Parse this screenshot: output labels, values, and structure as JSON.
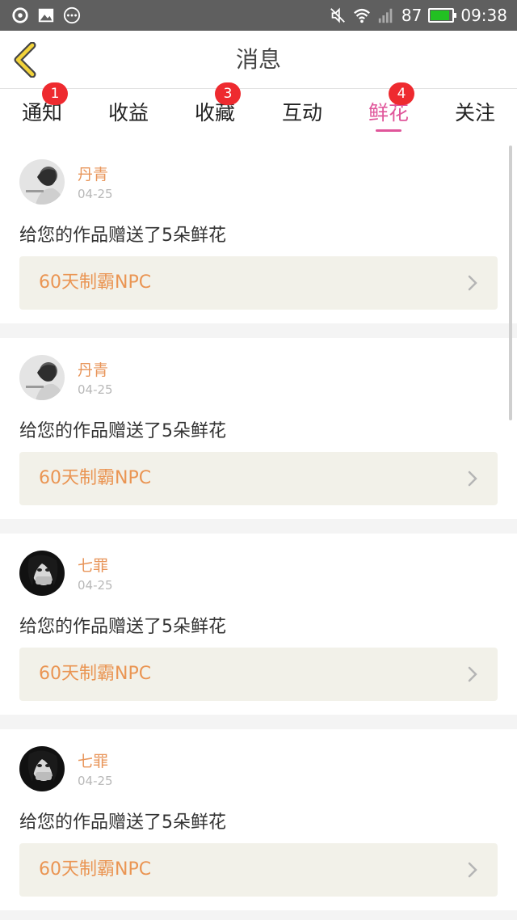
{
  "status_bar": {
    "battery": "87",
    "time": "09:38",
    "left_icons": [
      "sync-icon",
      "image-icon",
      "more-dots-icon"
    ],
    "right_icons": [
      "mute-icon",
      "wifi-icon",
      "signal-icon",
      "battery-icon"
    ],
    "battery_color": "#22c022"
  },
  "header": {
    "title": "消息"
  },
  "tabs": [
    {
      "label": "通知",
      "badge": "1"
    },
    {
      "label": "收益",
      "badge": ""
    },
    {
      "label": "收藏",
      "badge": "3"
    },
    {
      "label": "互动",
      "badge": ""
    },
    {
      "label": "鲜花",
      "badge": "4",
      "active": true
    },
    {
      "label": "关注",
      "badge": ""
    }
  ],
  "messages": [
    {
      "user": "丹青",
      "date": "04-25",
      "text": "给您的作品赠送了5朵鲜花",
      "work": "60天制霸NPC"
    },
    {
      "user": "丹青",
      "date": "04-25",
      "text": "给您的作品赠送了5朵鲜花",
      "work": "60天制霸NPC"
    },
    {
      "user": "七罪",
      "date": "04-25",
      "text": "给您的作品赠送了5朵鲜花",
      "work": "60天制霸NPC"
    },
    {
      "user": "七罪",
      "date": "04-25",
      "text": "给您的作品赠送了5朵鲜花",
      "work": "60天制霸NPC"
    }
  ],
  "colors": {
    "accent": "#e0559a",
    "badge": "#ee2a2f",
    "username": "#e8955a",
    "work_title": "#ea9553",
    "work_bg": "#f2f1e9"
  }
}
